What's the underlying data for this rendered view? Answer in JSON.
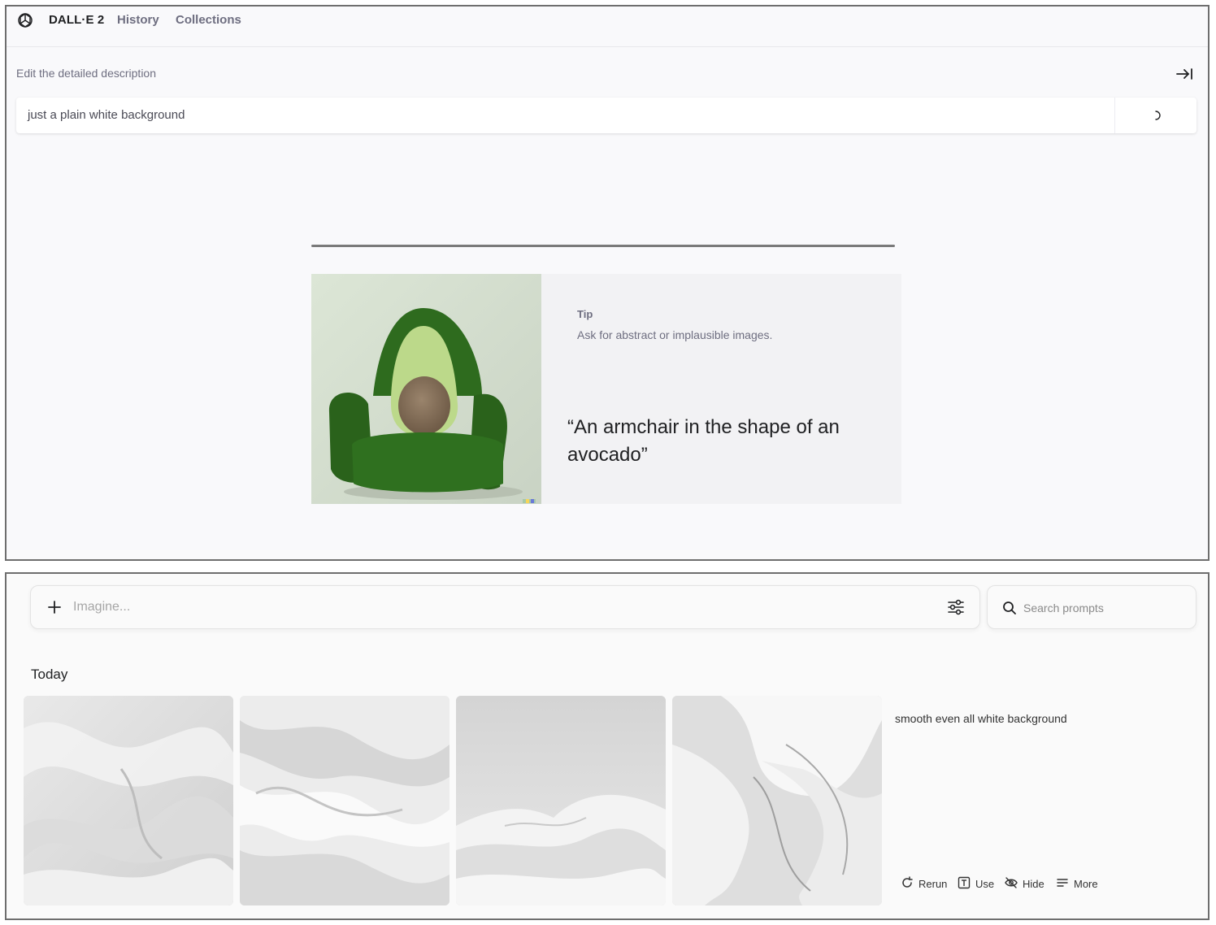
{
  "dalle": {
    "brand": "DALL·E 2",
    "nav": {
      "history": "History",
      "collections": "Collections"
    },
    "description_label": "Edit the detailed description",
    "prompt_value": "just a plain white background",
    "tip": {
      "label": "Tip",
      "text": "Ask for abstract or implausible images.",
      "quote": "“An armchair in the shape of an avocado”"
    },
    "icons": [
      "openai-logo-icon",
      "collapse-right-icon",
      "loading-spinner-icon"
    ]
  },
  "midjourney": {
    "imagine_placeholder": "Imagine...",
    "search_placeholder": "Search prompts",
    "section_heading": "Today",
    "job": {
      "prompt": "smooth even all white background",
      "actions": {
        "rerun": "Rerun",
        "use": "Use",
        "hide": "Hide",
        "more": "More"
      }
    },
    "icons": [
      "plus-icon",
      "settings-sliders-icon",
      "search-icon",
      "rerun-icon",
      "use-text-icon",
      "hide-eye-icon",
      "more-lines-icon"
    ]
  },
  "colors": {
    "dalle_bg": "#f9f9fb",
    "tip_bg": "#f2f2f4",
    "avocado_green": "#2f6b1f",
    "silk_white": "#eeeeee"
  }
}
